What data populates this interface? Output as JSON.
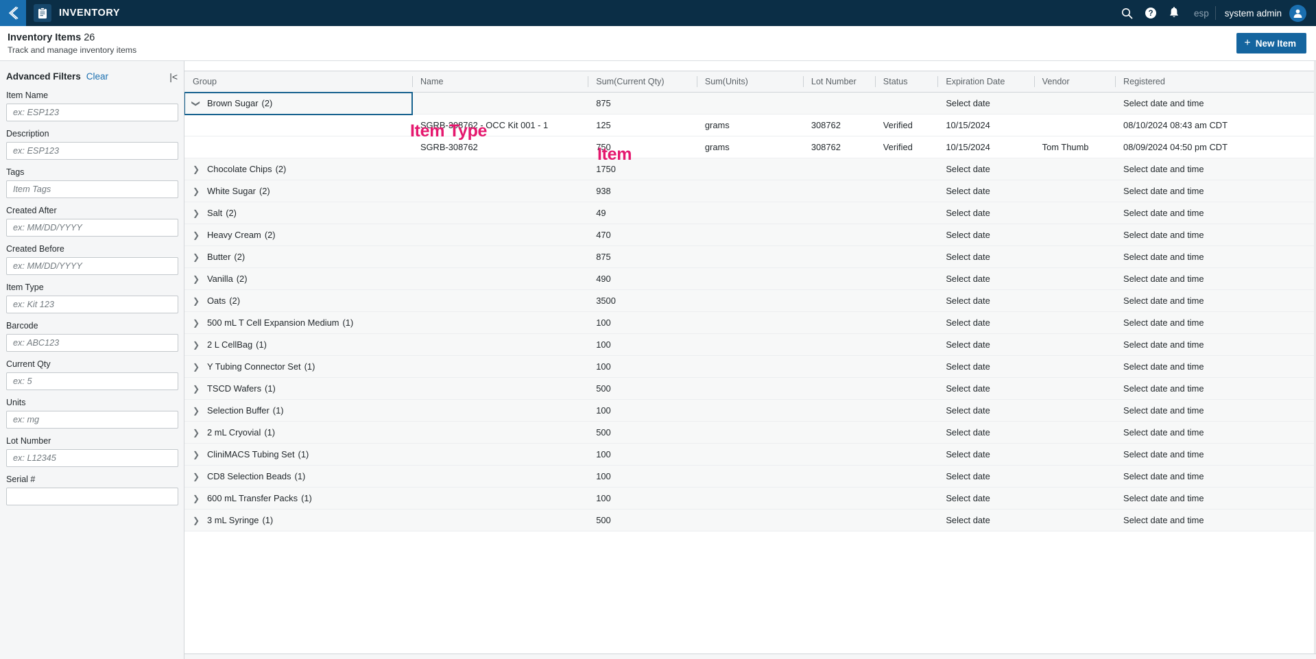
{
  "topbar": {
    "back_icon": "chevron-left-icon",
    "app_icon": "clipboard-icon",
    "app_title": "INVENTORY",
    "search_icon": "search-icon",
    "help_icon": "help-circle-icon",
    "notifications_icon": "bell-icon",
    "language": "esp",
    "username": "system admin",
    "avatar_icon": "user-avatar-icon",
    "bg_color": "#0b2e46",
    "accent_color": "#1a6fb0"
  },
  "page_header": {
    "title": "Inventory Items",
    "count": "26",
    "subtitle": "Track and manage inventory items",
    "new_item_label": "New Item",
    "new_item_plus": "+",
    "button_color": "#15659f"
  },
  "sidebar": {
    "title": "Advanced Filters",
    "clear_label": "Clear",
    "collapse_icon": "collapse-panel-icon",
    "fields": [
      {
        "label": "Item Name",
        "placeholder": "ex: ESP123",
        "value": ""
      },
      {
        "label": "Description",
        "placeholder": "ex: ESP123",
        "value": ""
      },
      {
        "label": "Tags",
        "placeholder": "Item Tags",
        "value": ""
      },
      {
        "label": "Created After",
        "placeholder": "ex: MM/DD/YYYY",
        "value": ""
      },
      {
        "label": "Created Before",
        "placeholder": "ex: MM/DD/YYYY",
        "value": ""
      },
      {
        "label": "Item Type",
        "placeholder": "ex: Kit 123",
        "value": ""
      },
      {
        "label": "Barcode",
        "placeholder": "ex: ABC123",
        "value": ""
      },
      {
        "label": "Current Qty",
        "placeholder": "ex: 5",
        "value": ""
      },
      {
        "label": "Units",
        "placeholder": "ex: mg",
        "value": ""
      },
      {
        "label": "Lot Number",
        "placeholder": "ex: L12345",
        "value": ""
      },
      {
        "label": "Serial #",
        "placeholder": "",
        "value": ""
      }
    ]
  },
  "annotations": {
    "item_type": "Item Type",
    "item": "Item",
    "color": "#e5186e"
  },
  "table": {
    "columns": [
      "Group",
      "Name",
      "Sum(Current Qty)",
      "Sum(Units)",
      "Lot Number",
      "Status",
      "Expiration Date",
      "Vendor",
      "Registered"
    ],
    "rows": [
      {
        "kind": "group",
        "expanded": true,
        "selected": true,
        "group": "Brown Sugar",
        "count": "(2)",
        "name": "",
        "qty": "875",
        "units": "",
        "lot": "",
        "status": "",
        "expiration": "Select date",
        "vendor": "",
        "registered": "Select date and time"
      },
      {
        "kind": "child",
        "group": "",
        "count": "",
        "name": "SGRB-308762 - OCC Kit 001 - 1",
        "qty": "125",
        "units": "grams",
        "lot": "308762",
        "status": "Verified",
        "expiration": "10/15/2024",
        "vendor": "",
        "registered": "08/10/2024 08:43 am CDT"
      },
      {
        "kind": "child",
        "group": "",
        "count": "",
        "name": "SGRB-308762",
        "qty": "750",
        "units": "grams",
        "lot": "308762",
        "status": "Verified",
        "expiration": "10/15/2024",
        "vendor": "Tom Thumb",
        "registered": "08/09/2024 04:50 pm CDT"
      },
      {
        "kind": "group",
        "expanded": false,
        "group": "Chocolate Chips",
        "count": "(2)",
        "name": "",
        "qty": "1750",
        "units": "",
        "lot": "",
        "status": "",
        "expiration": "Select date",
        "vendor": "",
        "registered": "Select date and time"
      },
      {
        "kind": "group",
        "expanded": false,
        "group": "White Sugar",
        "count": "(2)",
        "name": "",
        "qty": "938",
        "units": "",
        "lot": "",
        "status": "",
        "expiration": "Select date",
        "vendor": "",
        "registered": "Select date and time"
      },
      {
        "kind": "group",
        "expanded": false,
        "group": "Salt",
        "count": "(2)",
        "name": "",
        "qty": "49",
        "units": "",
        "lot": "",
        "status": "",
        "expiration": "Select date",
        "vendor": "",
        "registered": "Select date and time"
      },
      {
        "kind": "group",
        "expanded": false,
        "group": "Heavy Cream",
        "count": "(2)",
        "name": "",
        "qty": "470",
        "units": "",
        "lot": "",
        "status": "",
        "expiration": "Select date",
        "vendor": "",
        "registered": "Select date and time"
      },
      {
        "kind": "group",
        "expanded": false,
        "group": "Butter",
        "count": "(2)",
        "name": "",
        "qty": "875",
        "units": "",
        "lot": "",
        "status": "",
        "expiration": "Select date",
        "vendor": "",
        "registered": "Select date and time"
      },
      {
        "kind": "group",
        "expanded": false,
        "group": "Vanilla",
        "count": "(2)",
        "name": "",
        "qty": "490",
        "units": "",
        "lot": "",
        "status": "",
        "expiration": "Select date",
        "vendor": "",
        "registered": "Select date and time"
      },
      {
        "kind": "group",
        "expanded": false,
        "group": "Oats",
        "count": "(2)",
        "name": "",
        "qty": "3500",
        "units": "",
        "lot": "",
        "status": "",
        "expiration": "Select date",
        "vendor": "",
        "registered": "Select date and time"
      },
      {
        "kind": "group",
        "expanded": false,
        "group": "500 mL T Cell Expansion Medium",
        "count": "(1)",
        "name": "",
        "qty": "100",
        "units": "",
        "lot": "",
        "status": "",
        "expiration": "Select date",
        "vendor": "",
        "registered": "Select date and time"
      },
      {
        "kind": "group",
        "expanded": false,
        "group": "2 L CellBag",
        "count": "(1)",
        "name": "",
        "qty": "100",
        "units": "",
        "lot": "",
        "status": "",
        "expiration": "Select date",
        "vendor": "",
        "registered": "Select date and time"
      },
      {
        "kind": "group",
        "expanded": false,
        "group": "Y Tubing Connector Set",
        "count": "(1)",
        "name": "",
        "qty": "100",
        "units": "",
        "lot": "",
        "status": "",
        "expiration": "Select date",
        "vendor": "",
        "registered": "Select date and time"
      },
      {
        "kind": "group",
        "expanded": false,
        "group": "TSCD Wafers",
        "count": "(1)",
        "name": "",
        "qty": "500",
        "units": "",
        "lot": "",
        "status": "",
        "expiration": "Select date",
        "vendor": "",
        "registered": "Select date and time"
      },
      {
        "kind": "group",
        "expanded": false,
        "group": "Selection Buffer",
        "count": "(1)",
        "name": "",
        "qty": "100",
        "units": "",
        "lot": "",
        "status": "",
        "expiration": "Select date",
        "vendor": "",
        "registered": "Select date and time"
      },
      {
        "kind": "group",
        "expanded": false,
        "group": "2 mL Cryovial",
        "count": "(1)",
        "name": "",
        "qty": "500",
        "units": "",
        "lot": "",
        "status": "",
        "expiration": "Select date",
        "vendor": "",
        "registered": "Select date and time"
      },
      {
        "kind": "group",
        "expanded": false,
        "group": "CliniMACS Tubing Set",
        "count": "(1)",
        "name": "",
        "qty": "100",
        "units": "",
        "lot": "",
        "status": "",
        "expiration": "Select date",
        "vendor": "",
        "registered": "Select date and time"
      },
      {
        "kind": "group",
        "expanded": false,
        "group": "CD8 Selection Beads",
        "count": "(1)",
        "name": "",
        "qty": "100",
        "units": "",
        "lot": "",
        "status": "",
        "expiration": "Select date",
        "vendor": "",
        "registered": "Select date and time"
      },
      {
        "kind": "group",
        "expanded": false,
        "group": "600 mL Transfer Packs",
        "count": "(1)",
        "name": "",
        "qty": "100",
        "units": "",
        "lot": "",
        "status": "",
        "expiration": "Select date",
        "vendor": "",
        "registered": "Select date and time"
      },
      {
        "kind": "group",
        "expanded": false,
        "group": "3 mL Syringe",
        "count": "(1)",
        "name": "",
        "qty": "500",
        "units": "",
        "lot": "",
        "status": "",
        "expiration": "Select date",
        "vendor": "",
        "registered": "Select date and time"
      }
    ]
  }
}
